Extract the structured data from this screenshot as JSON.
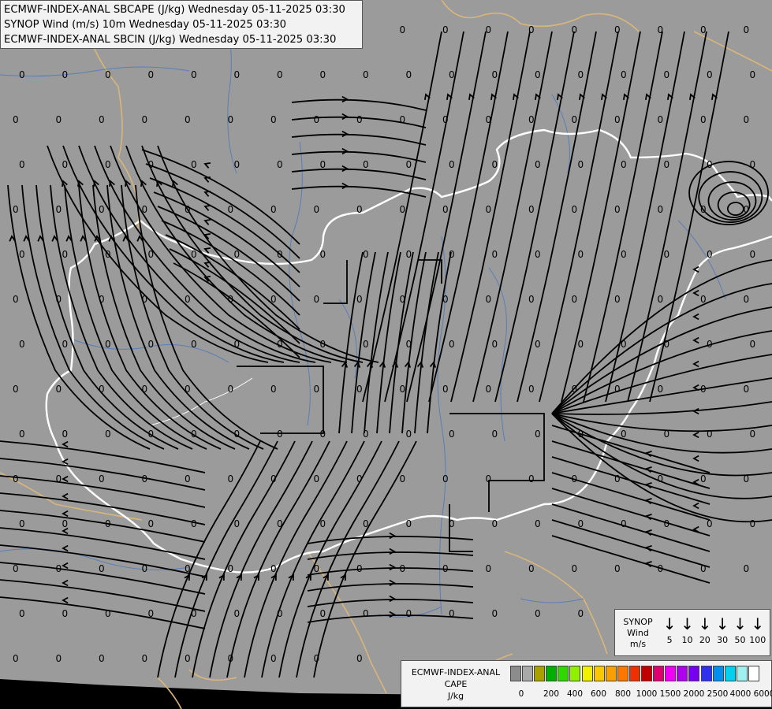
{
  "title_lines": [
    "ECMWF-INDEX-ANAL SBCAPE (J/kg) Wednesday 05-11-2025 03:30",
    "SYNOP Wind (m/s) 10m Wednesday 05-11-2025 03:30",
    "ECMWF-INDEX-ANAL SBCIN (J/kg) Wednesday 05-11-2025 03:30"
  ],
  "map": {
    "background_color": "#9b9b9b",
    "border_color": "#ffffff",
    "neighbor_border_color": "#d8b67a",
    "river_color": "#5a7fb5",
    "streamline_color": "#000000",
    "value_label": "0",
    "value_grid": {
      "rows": 15,
      "cols": 18
    }
  },
  "synop_legend": {
    "title": [
      "SYNOP",
      "Wind",
      "m/s"
    ],
    "speeds": [
      "5",
      "10",
      "20",
      "30",
      "50",
      "100"
    ]
  },
  "cape_legend": {
    "title": [
      "ECMWF-INDEX-ANAL",
      "CAPE",
      "J/kg"
    ],
    "colors": [
      "#8c8c8c",
      "#a9a9a9",
      "#a8a000",
      "#00b000",
      "#30d800",
      "#90f000",
      "#f0f000",
      "#f8c800",
      "#f8a000",
      "#f87800",
      "#f03000",
      "#c00000",
      "#e00070",
      "#f000f0",
      "#b000f0",
      "#7800f0",
      "#3030f0",
      "#0090f0",
      "#00d0f0",
      "#a0f0f0",
      "#ffffff"
    ],
    "ticks": [
      "0",
      "200",
      "400",
      "600",
      "800",
      "1000",
      "1500",
      "2000",
      "2500",
      "4000",
      "6000"
    ]
  }
}
